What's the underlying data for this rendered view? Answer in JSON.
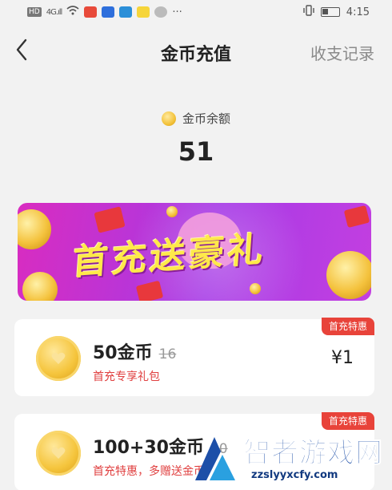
{
  "status_bar": {
    "time": "4:15",
    "hd": "HD",
    "signal": "4G.ıll"
  },
  "header": {
    "title": "金币充值",
    "records_label": "收支记录"
  },
  "balance": {
    "label": "金币余额",
    "value": "51"
  },
  "banner": {
    "text": "首充送豪礼"
  },
  "packages": [
    {
      "name": "50金币",
      "original": "16",
      "desc": "首充专享礼包",
      "price": "¥1",
      "tag": "首充特惠"
    },
    {
      "name": "100+30金币",
      "original": "10",
      "desc": "首充特惠，多赠送金币",
      "price": "",
      "tag": "首充特惠"
    }
  ],
  "watermark": {
    "text": "智者游戏网",
    "url": "zzslyyxcfy.com"
  },
  "colors": {
    "accent_red": "#e8433a",
    "coin_gold": "#f5c53d",
    "banner_purple": "#a63ae6",
    "watermark_blue": "#1d4fa8"
  }
}
